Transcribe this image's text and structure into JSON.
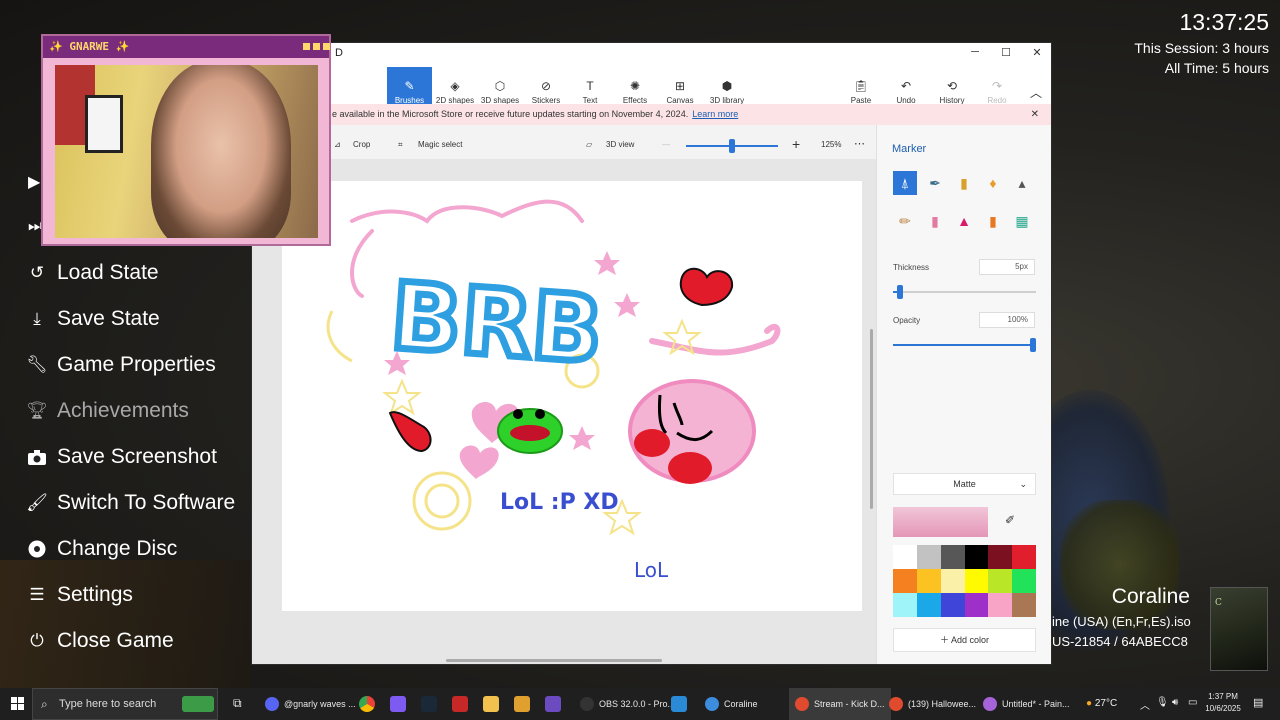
{
  "overlay": {
    "clock": "13:37:25",
    "session": "This Session: 3 hours",
    "all_time": "All Time: 5 hours"
  },
  "game_menu": {
    "items": [
      {
        "label": "Load State",
        "icon": "undo-icon",
        "enabled": true
      },
      {
        "label": "Save State",
        "icon": "download-icon",
        "enabled": true
      },
      {
        "label": "Game Properties",
        "icon": "wrench-icon",
        "enabled": true
      },
      {
        "label": "Achievements",
        "icon": "trophy-icon",
        "enabled": false
      },
      {
        "label": "Save Screenshot",
        "icon": "camera-icon",
        "enabled": true
      },
      {
        "label": "Switch To Software",
        "icon": "brush-icon",
        "enabled": true
      },
      {
        "label": "Change Disc",
        "icon": "disc-icon",
        "enabled": true
      },
      {
        "label": "Settings",
        "icon": "sliders-icon",
        "enabled": true
      },
      {
        "label": "Close Game",
        "icon": "power-icon",
        "enabled": true
      }
    ]
  },
  "game": {
    "title": "Coraline",
    "iso": "ine (USA) (En,Fr,Es).iso",
    "serial": "US-21854 / 64ABECC8"
  },
  "webcam": {
    "title": "✨ GNARWE ✨"
  },
  "paint": {
    "title_fragment": "D",
    "ribbon": [
      {
        "label": "Brushes",
        "active": true
      },
      {
        "label": "2D shapes",
        "active": false
      },
      {
        "label": "3D shapes",
        "active": false
      },
      {
        "label": "Stickers",
        "active": false
      },
      {
        "label": "Text",
        "active": false
      },
      {
        "label": "Effects",
        "active": false
      },
      {
        "label": "Canvas",
        "active": false
      },
      {
        "label": "3D library",
        "active": false
      }
    ],
    "ribbon_right": [
      {
        "label": "Paste",
        "enabled": true
      },
      {
        "label": "Undo",
        "enabled": true
      },
      {
        "label": "History",
        "enabled": true
      },
      {
        "label": "Redo",
        "enabled": false
      }
    ],
    "notice": "e available in the Microsoft Store or receive future updates starting on November 4, 2024.",
    "notice_link": "Learn more",
    "toolbar": {
      "crop": "Crop",
      "magic_select": "Magic select",
      "view3d": "3D view",
      "zoom": "125%",
      "zoom_level": 0.5
    },
    "panel": {
      "title": "Marker",
      "thickness_label": "Thickness",
      "thickness_value": "5px",
      "thickness_level": 0.05,
      "opacity_label": "Opacity",
      "opacity_value": "100%",
      "opacity_level": 1.0,
      "finish": "Matte",
      "add_color": "Add color",
      "palette": [
        "#ffffff",
        "#c2c2c2",
        "#575757",
        "#000000",
        "#7a1020",
        "#e01e2c",
        "#f5801f",
        "#fcc221",
        "#fbf0a8",
        "#fffa00",
        "#b9e626",
        "#22e25a",
        "#9ef4f8",
        "#1aa8e8",
        "#3e45d8",
        "#9f2fc9",
        "#f7a4c7",
        "#a97753"
      ]
    },
    "drawing": {
      "text_brb": "BRB",
      "text_lol1": "LoL :P XD",
      "text_lol2": "LoL"
    }
  },
  "taskbar": {
    "search_placeholder": "Type here to search",
    "apps": [
      {
        "label": "@gnarly waves ...",
        "color": "#5865f2"
      },
      {
        "label": "OBS 32.0.0 - Pro...",
        "color": "#333333"
      },
      {
        "label": "Coraline",
        "color": "#3c8dde"
      },
      {
        "label": "Stream - Kick D...",
        "color": "#e04a2f"
      },
      {
        "label": "(139) Hallowee...",
        "color": "#e04a2f"
      },
      {
        "label": "Untitled* - Pain...",
        "color": "#a663d9"
      }
    ],
    "weather": "27°C",
    "time": "1:37 PM",
    "date": "10/6/2025"
  }
}
